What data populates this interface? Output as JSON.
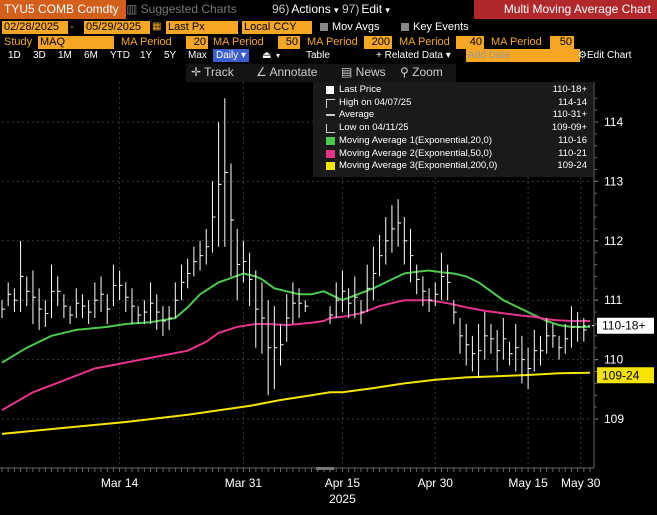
{
  "header": {
    "ticker": "TYU5 COMB Comdty",
    "suggested_charts": "Suggested Charts",
    "actions_num": "96)",
    "actions_label": "Actions",
    "edit_num": "97)",
    "edit_label": "Edit",
    "chart_title": "Multi Moving Average Chart"
  },
  "controls": {
    "start_date": "02/28/2025",
    "end_date": "05/29/2025",
    "price_field": "Last Px",
    "currency": "Local CCY",
    "mov_avgs": "Mov Avgs",
    "key_events": "Key Events",
    "study_label": "Study",
    "study_value": "MAQ",
    "ma_periods": [
      {
        "label": "MA Period",
        "value": "20"
      },
      {
        "label": "MA Period",
        "value": "50"
      },
      {
        "label": "MA Period",
        "value": "200"
      },
      {
        "label": "MA Period",
        "value": "40"
      },
      {
        "label": "MA Period",
        "value": "50"
      }
    ],
    "ranges": [
      "1D",
      "3D",
      "1M",
      "6M",
      "YTD",
      "1Y",
      "5Y",
      "Max"
    ],
    "frequency": "Daily",
    "table_label": "Table",
    "related_data": "Related Data",
    "add_data_placeholder": "Add Data",
    "edit_chart": "Edit Chart"
  },
  "toolbar": {
    "track": "Track",
    "annotate": "Annotate",
    "news": "News",
    "zoom": "Zoom"
  },
  "legend": {
    "items": [
      {
        "label": "Last Price",
        "value": "110-18+",
        "icon": "white-square",
        "color": "#ffffff"
      },
      {
        "label": "High on 04/07/25",
        "value": "114-14",
        "icon": "high-marker",
        "color": "#cccccc"
      },
      {
        "label": "Average",
        "value": "110-31+",
        "icon": "average-marker",
        "color": "#cccccc"
      },
      {
        "label": "Low on 04/11/25",
        "value": "109-09+",
        "icon": "low-marker",
        "color": "#cccccc"
      },
      {
        "label": "Moving Average 1(Exponential,20,0)",
        "value": "110-16",
        "icon": "green-square",
        "color": "#4cc94c"
      },
      {
        "label": "Moving Average 2(Exponential,50,0)",
        "value": "110-21",
        "icon": "pink-square",
        "color": "#e8338a"
      },
      {
        "label": "Moving Average 3(Exponential,200,0)",
        "value": "109-24",
        "icon": "yellow-square",
        "color": "#f5e400"
      }
    ]
  },
  "chart_data": {
    "type": "line",
    "y_ticks": [
      "114",
      "113",
      "112",
      "111",
      "110",
      "109"
    ],
    "x_ticks": [
      "Mar 14",
      "Mar 31",
      "Apr 15",
      "Apr 30",
      "May 15",
      "May 30"
    ],
    "x_year": "2025",
    "ylim": [
      108.3,
      114.8
    ],
    "last_price_tag": "110-18+",
    "ma3_tag": "109-24",
    "grid": true,
    "series": [
      {
        "name": "Moving Average 1(Exponential,20,0)",
        "color": "#4cc94c",
        "x": [
          0,
          8,
          16,
          24,
          34,
          40,
          48,
          56,
          60,
          64,
          70,
          78,
          82,
          84,
          88,
          92,
          96,
          100,
          104,
          106,
          110,
          114,
          120,
          126,
          130,
          134,
          138,
          142,
          146,
          150,
          154,
          158,
          162,
          166,
          168,
          172,
          176,
          180,
          184,
          188,
          190
        ],
        "values": [
          109.95,
          110.2,
          110.4,
          110.5,
          110.55,
          110.6,
          110.63,
          110.7,
          110.88,
          111.1,
          111.3,
          111.45,
          111.4,
          111.35,
          111.2,
          111.15,
          111.1,
          111.1,
          111.15,
          111.1,
          111.0,
          111.08,
          111.2,
          111.35,
          111.45,
          111.48,
          111.5,
          111.47,
          111.45,
          111.4,
          111.3,
          111.15,
          111.0,
          110.9,
          110.85,
          110.75,
          110.65,
          110.58,
          110.55,
          110.55,
          110.55
        ]
      },
      {
        "name": "Moving Average 2(Exponential,50,0)",
        "color": "#e8338a",
        "x": [
          0,
          10,
          20,
          30,
          40,
          50,
          60,
          66,
          70,
          76,
          82,
          86,
          92,
          96,
          100,
          104,
          106,
          110,
          116,
          122,
          130,
          138,
          144,
          150,
          156,
          162,
          168,
          172,
          176,
          180,
          184,
          188,
          190
        ],
        "values": [
          109.15,
          109.45,
          109.65,
          109.85,
          109.95,
          110.05,
          110.15,
          110.3,
          110.45,
          110.55,
          110.6,
          110.6,
          110.58,
          110.6,
          110.62,
          110.65,
          110.7,
          110.72,
          110.78,
          110.9,
          111.0,
          111.0,
          110.95,
          110.88,
          110.82,
          110.78,
          110.74,
          110.72,
          110.68,
          110.66,
          110.65,
          110.65,
          110.65
        ]
      },
      {
        "name": "Moving Average 3(Exponential,200,0)",
        "color": "#f5e400",
        "x": [
          0,
          20,
          40,
          60,
          80,
          90,
          100,
          106,
          110,
          120,
          130,
          140,
          150,
          160,
          170,
          180,
          190
        ],
        "values": [
          108.75,
          108.85,
          108.95,
          109.07,
          109.22,
          109.32,
          109.4,
          109.45,
          109.45,
          109.52,
          109.6,
          109.66,
          109.7,
          109.72,
          109.74,
          109.77,
          109.78
        ]
      }
    ],
    "price_bars": [
      {
        "x": 0,
        "h": 111.0,
        "l": 110.7
      },
      {
        "x": 2,
        "h": 111.3,
        "l": 110.9
      },
      {
        "x": 4,
        "h": 111.2,
        "l": 110.8
      },
      {
        "x": 6,
        "h": 112.0,
        "l": 110.8
      },
      {
        "x": 8,
        "h": 111.4,
        "l": 110.9
      },
      {
        "x": 10,
        "h": 111.5,
        "l": 110.6
      },
      {
        "x": 12,
        "h": 111.2,
        "l": 110.5
      },
      {
        "x": 14,
        "h": 111.0,
        "l": 110.55
      },
      {
        "x": 16,
        "h": 111.6,
        "l": 110.7
      },
      {
        "x": 18,
        "h": 111.4,
        "l": 110.9
      },
      {
        "x": 20,
        "h": 111.1,
        "l": 110.7
      },
      {
        "x": 22,
        "h": 110.9,
        "l": 110.6
      },
      {
        "x": 24,
        "h": 111.2,
        "l": 110.7
      },
      {
        "x": 26,
        "h": 111.1,
        "l": 110.7
      },
      {
        "x": 28,
        "h": 111.0,
        "l": 110.6
      },
      {
        "x": 30,
        "h": 111.3,
        "l": 110.7
      },
      {
        "x": 32,
        "h": 111.4,
        "l": 110.8
      },
      {
        "x": 34,
        "h": 111.1,
        "l": 110.6
      },
      {
        "x": 36,
        "h": 111.6,
        "l": 110.9
      },
      {
        "x": 38,
        "h": 111.5,
        "l": 111.0
      },
      {
        "x": 40,
        "h": 111.3,
        "l": 110.8
      },
      {
        "x": 42,
        "h": 111.2,
        "l": 110.6
      },
      {
        "x": 44,
        "h": 110.9,
        "l": 110.6
      },
      {
        "x": 46,
        "h": 111.0,
        "l": 110.6
      },
      {
        "x": 48,
        "h": 111.3,
        "l": 110.6
      },
      {
        "x": 50,
        "h": 111.1,
        "l": 110.5
      },
      {
        "x": 52,
        "h": 110.9,
        "l": 110.4
      },
      {
        "x": 54,
        "h": 110.9,
        "l": 110.5
      },
      {
        "x": 56,
        "h": 111.3,
        "l": 110.7
      },
      {
        "x": 58,
        "h": 111.6,
        "l": 111.0
      },
      {
        "x": 60,
        "h": 111.7,
        "l": 111.2
      },
      {
        "x": 62,
        "h": 111.9,
        "l": 111.4
      },
      {
        "x": 64,
        "h": 112.0,
        "l": 111.5
      },
      {
        "x": 66,
        "h": 112.2,
        "l": 111.6
      },
      {
        "x": 68,
        "h": 113.0,
        "l": 111.8
      },
      {
        "x": 70,
        "h": 114.0,
        "l": 111.9
      },
      {
        "x": 72,
        "h": 114.4,
        "l": 111.9
      },
      {
        "x": 74,
        "h": 113.3,
        "l": 111.4
      },
      {
        "x": 76,
        "h": 112.2,
        "l": 111.0
      },
      {
        "x": 78,
        "h": 112.0,
        "l": 111.3
      },
      {
        "x": 80,
        "h": 111.8,
        "l": 110.9
      },
      {
        "x": 82,
        "h": 111.5,
        "l": 110.2
      },
      {
        "x": 84,
        "h": 111.3,
        "l": 110.1
      },
      {
        "x": 86,
        "h": 111.0,
        "l": 109.4
      },
      {
        "x": 88,
        "h": 110.9,
        "l": 109.5
      },
      {
        "x": 90,
        "h": 110.6,
        "l": 109.9
      },
      {
        "x": 92,
        "h": 111.1,
        "l": 110.3
      },
      {
        "x": 94,
        "h": 111.3,
        "l": 110.6
      },
      {
        "x": 96,
        "h": 111.2,
        "l": 110.7
      },
      {
        "x": 98,
        "h": 111.0,
        "l": 110.8
      },
      {
        "x": 106,
        "h": 110.9,
        "l": 110.6
      },
      {
        "x": 108,
        "h": 111.3,
        "l": 110.7
      },
      {
        "x": 110,
        "h": 111.5,
        "l": 110.8
      },
      {
        "x": 112,
        "h": 111.2,
        "l": 110.7
      },
      {
        "x": 114,
        "h": 111.4,
        "l": 110.7
      },
      {
        "x": 116,
        "h": 111.0,
        "l": 110.6
      },
      {
        "x": 118,
        "h": 111.6,
        "l": 110.8
      },
      {
        "x": 120,
        "h": 111.9,
        "l": 111.0
      },
      {
        "x": 122,
        "h": 112.1,
        "l": 111.4
      },
      {
        "x": 124,
        "h": 112.4,
        "l": 111.6
      },
      {
        "x": 126,
        "h": 112.6,
        "l": 111.8
      },
      {
        "x": 128,
        "h": 112.7,
        "l": 111.9
      },
      {
        "x": 130,
        "h": 112.4,
        "l": 111.6
      },
      {
        "x": 132,
        "h": 112.2,
        "l": 111.3
      },
      {
        "x": 134,
        "h": 111.6,
        "l": 111.1
      },
      {
        "x": 136,
        "h": 111.4,
        "l": 110.9
      },
      {
        "x": 138,
        "h": 111.2,
        "l": 110.8
      },
      {
        "x": 140,
        "h": 111.3,
        "l": 110.9
      },
      {
        "x": 142,
        "h": 111.8,
        "l": 111.0
      },
      {
        "x": 144,
        "h": 111.6,
        "l": 111.0
      },
      {
        "x": 146,
        "h": 111.0,
        "l": 110.6
      },
      {
        "x": 148,
        "h": 110.7,
        "l": 110.1
      },
      {
        "x": 150,
        "h": 110.6,
        "l": 109.9
      },
      {
        "x": 152,
        "h": 110.4,
        "l": 109.8
      },
      {
        "x": 154,
        "h": 110.6,
        "l": 109.7
      },
      {
        "x": 156,
        "h": 110.8,
        "l": 110.0
      },
      {
        "x": 158,
        "h": 110.6,
        "l": 110.1
      },
      {
        "x": 160,
        "h": 110.5,
        "l": 109.8
      },
      {
        "x": 162,
        "h": 110.7,
        "l": 110.0
      },
      {
        "x": 164,
        "h": 110.3,
        "l": 109.9
      },
      {
        "x": 166,
        "h": 110.6,
        "l": 109.8
      },
      {
        "x": 168,
        "h": 110.4,
        "l": 109.6
      },
      {
        "x": 170,
        "h": 110.2,
        "l": 109.5
      },
      {
        "x": 172,
        "h": 110.5,
        "l": 109.8
      },
      {
        "x": 174,
        "h": 110.4,
        "l": 109.9
      },
      {
        "x": 176,
        "h": 110.7,
        "l": 110.1
      },
      {
        "x": 178,
        "h": 110.6,
        "l": 110.2
      },
      {
        "x": 180,
        "h": 110.4,
        "l": 110.0
      },
      {
        "x": 182,
        "h": 110.6,
        "l": 110.1
      },
      {
        "x": 184,
        "h": 110.9,
        "l": 110.2
      },
      {
        "x": 186,
        "h": 110.8,
        "l": 110.3
      },
      {
        "x": 188,
        "h": 110.7,
        "l": 110.3
      }
    ],
    "last_price": 110.57,
    "ma3_last": 109.77,
    "x_domain": [
      0,
      190
    ]
  },
  "colors": {
    "accent_orange": "#f5a623",
    "title_red": "#b1282b",
    "ticker_orange": "#d45f1b",
    "daily_blue": "#3a5fcd"
  }
}
